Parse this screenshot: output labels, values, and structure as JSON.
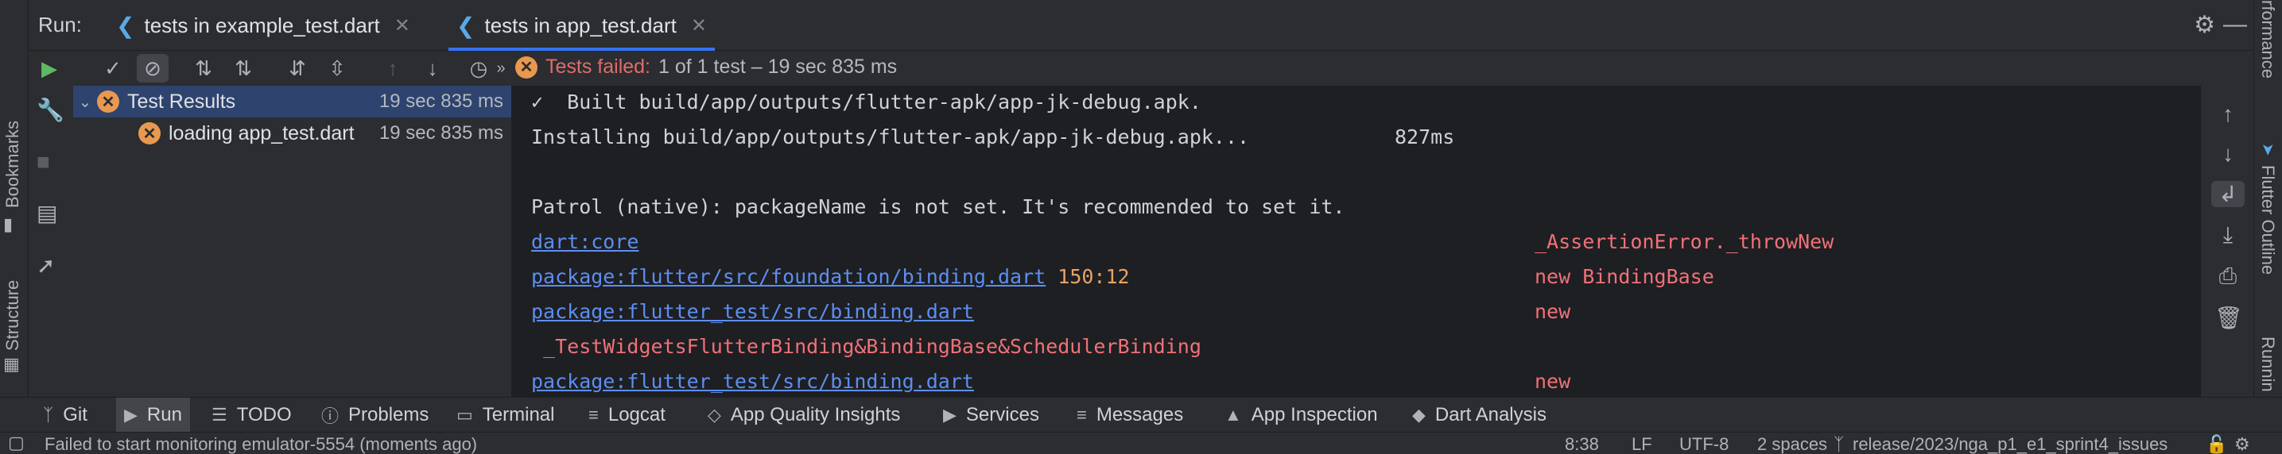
{
  "left_strip": {
    "bookmarks": "Bookmarks",
    "structure": "Structure"
  },
  "right_strip": {
    "performance": "rformance",
    "flutter_outline": "Flutter Outline",
    "running": "Runnin"
  },
  "run": {
    "label": "Run:",
    "tabs": [
      {
        "label": "tests in example_test.dart",
        "active": false
      },
      {
        "label": "tests in app_test.dart",
        "active": true
      }
    ]
  },
  "status": {
    "failed": "Tests failed:",
    "rest": "1 of 1 test – 19 sec 835 ms"
  },
  "tree": {
    "root": {
      "label": "Test Results",
      "time": "19 sec 835 ms"
    },
    "child": {
      "label": "loading app_test.dart",
      "time": "19 sec 835 ms"
    }
  },
  "console": {
    "line1": "✓  Built build/app/outputs/flutter-apk/app-jk-debug.apk.",
    "line2": "Installing build/app/outputs/flutter-apk/app-jk-debug.apk...",
    "line2_ms": "827ms",
    "line3": "Patrol (native): packageName is not set. It's recommended to set it.",
    "line4_link": "dart:core",
    "line4_right": "_AssertionError._throwNew",
    "line5_link": "package:flutter/src/foundation/binding.dart",
    "line5_num": "150:12",
    "line5_right": "new BindingBase",
    "line6_link": "package:flutter_test/src/binding.dart",
    "line6_right": "new",
    "line7": " _TestWidgetsFlutterBinding&BindingBase&SchedulerBinding",
    "line8_link": "package:flutter_test/src/binding.dart",
    "line8_right": "new"
  },
  "bottom_tools": [
    {
      "label": "Git",
      "icon": "git-icon"
    },
    {
      "label": "Run",
      "icon": "run-icon",
      "active": true
    },
    {
      "label": "TODO",
      "icon": "todo-icon"
    },
    {
      "label": "Problems",
      "icon": "problems-icon"
    },
    {
      "label": "Terminal",
      "icon": "terminal-icon"
    },
    {
      "label": "Logcat",
      "icon": "logcat-icon"
    },
    {
      "label": "App Quality Insights",
      "icon": "diamond-icon"
    },
    {
      "label": "Services",
      "icon": "services-icon"
    },
    {
      "label": "Messages",
      "icon": "messages-icon"
    },
    {
      "label": "App Inspection",
      "icon": "android-icon"
    },
    {
      "label": "Dart Analysis",
      "icon": "dart-icon"
    }
  ],
  "statusbar": {
    "message": "Failed to start monitoring emulator-5554 (moments ago)",
    "position": "8:38",
    "line_sep": "LF",
    "encoding": "UTF-8",
    "indent": "2 spaces",
    "branch": "release/2023/nga_p1_e1_sprint4_issues"
  },
  "colors": {
    "accent": "#3574f0",
    "fail": "#e06c6c",
    "link": "#5c8ef2",
    "console_bg": "#1e1f22"
  }
}
